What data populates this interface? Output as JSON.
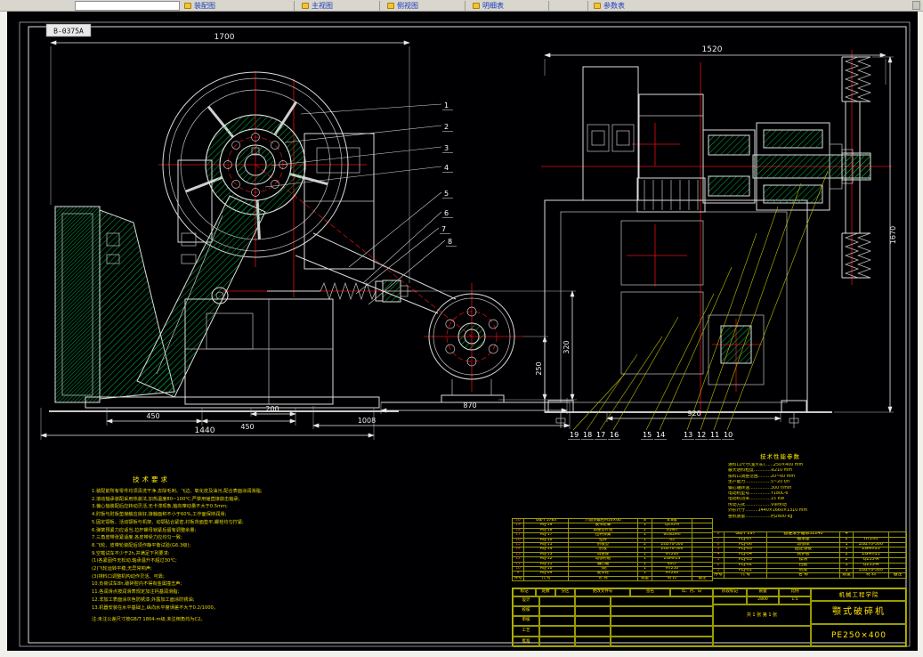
{
  "topbar": {
    "tabs": [
      {
        "label": "装配图"
      },
      {
        "label": "主视图"
      },
      {
        "label": "侧视图"
      },
      {
        "label": "明细表"
      },
      {
        "label": "参数表"
      }
    ]
  },
  "frame": {
    "doc_no": "B-0375A"
  },
  "dims": {
    "front": {
      "total_width": "1700",
      "left450": "450",
      "mid200": "200",
      "right450": "450",
      "base_width": "1440",
      "pulley_offset": "1008",
      "belt_center": "870",
      "h250": "250",
      "h320": "320"
    },
    "side": {
      "total_width": "1520",
      "total_height": "1670",
      "base_width": "920"
    }
  },
  "callouts": {
    "front": [
      "1",
      "2",
      "3",
      "4",
      "5",
      "6",
      "7",
      "8"
    ],
    "side": [
      "19",
      "18",
      "17",
      "16",
      "15",
      "14",
      "13",
      "12",
      "11",
      "10"
    ]
  },
  "tech_requirements": {
    "title": "技术要求",
    "lines": [
      "1.装配前所有零件均须清洗干净,去除毛刺、飞边、氧化皮及油污,配合表面涂润滑脂;",
      "2.滚动轴承装配采用热装法,加热温度80~100℃,严禁用锤直接敲击轴承;",
      "3.偏心轴装配后应转动灵活,无卡滞现象,轴向窜动量不大于0.5mm;",
      "4.肘板与肘板垫接触应良好,接触面积不小于60%,工作面保持润滑;",
      "5.固定颚板、活动颚板与机架、动颚贴合紧密,衬板背面垫平,螺栓均匀拧紧;",
      "6.弹簧预紧力应适当,拉杆螺母锁紧后留有调整余量;",
      "7.三角皮带张紧适度,各皮带受力应均匀一致;",
      "8.飞轮、皮带轮装配后须作静平衡试验(G6.3级);",
      "9.空载试车不少于2h,并满足下列要求:",
      "  (1)各紧固件无松动,轴承温升不超过30℃;",
      "  (2)飞轮运转平稳,无异常响声;",
      "  (3)排料口调整机构动作灵活、可靠;",
      "10.负荷试车8h,破碎腔内不得有金属撞击声;",
      "11.各润滑点按润滑表规定加注钙基润滑脂;",
      "12.非加工表面涂灰色防锈漆,外露加工面涂防锈油;",
      "13.机器安装在水平基础上,纵向水平度误差不大于0.2/1000。"
    ],
    "note": "注:未注公差尺寸按GB/T 1804-m级,未注倒角均为C2。"
  },
  "tech_params": {
    "title": "技术性能参数",
    "lines": [
      "进料口尺寸(宽×长)……250×400 mm",
      "最大进料粒度…………≤210 mm",
      "排料口调整范围………20~60 mm",
      "生产能力………………5~20 t/h",
      "偏心轴转速……………300 r/min",
      "电动机型号……………Y180L-6",
      "电动机功率……………15 kW",
      "传动方式………………V带传动",
      "外形尺寸………1440×1660×1310 mm",
      "整机质量………………约2800 kg"
    ]
  },
  "bom": {
    "columns": [
      "序号",
      "代  号",
      "名  称",
      "数量",
      "材  料",
      "备注"
    ],
    "left_rows": [
      [
        "20",
        "GB/T 5783",
        "六角头螺栓M16×60",
        "8",
        "8.8级",
        ""
      ],
      [
        "19",
        "PEJ-19",
        "皮带轮罩",
        "1",
        "Q235-A",
        ""
      ],
      [
        "18",
        "PEJ-18",
        "调整垫片组",
        "2",
        "65Mn",
        ""
      ],
      [
        "17",
        "PEJ-17",
        "拉杆弹簧",
        "1",
        "60Si2Mn",
        ""
      ],
      [
        "16",
        "PEJ-16",
        "拉杆",
        "1",
        "45",
        ""
      ],
      [
        "15",
        "PEJ-15",
        "肘板垫",
        "2",
        "ZG270-500",
        ""
      ],
      [
        "14",
        "PEJ-14",
        "肘板",
        "1",
        "ZG270-500",
        ""
      ],
      [
        "13",
        "PEJ-13",
        "调整座",
        "1",
        "HT200",
        ""
      ],
      [
        "12",
        "PEJ-12",
        "动颚衬板",
        "1",
        "ZGMn13",
        ""
      ],
      [
        "11",
        "PEJ-11",
        "偏心轴",
        "1",
        "40Cr",
        ""
      ],
      [
        "10",
        "PEJ-10",
        "飞轮",
        "1",
        "HT250",
        ""
      ],
      [
        "9",
        "PEJ-09",
        "皮带轮",
        "1",
        "HT200",
        ""
      ]
    ],
    "right_rows": [
      [
        "8",
        "GB/T 297",
        "圆锥滚子轴承32240",
        "4",
        "",
        ""
      ],
      [
        "7",
        "PEJ-07",
        "轴承座",
        "2",
        "HT200",
        ""
      ],
      [
        "6",
        "PEJ-06",
        "动颚体",
        "1",
        "ZG270-500",
        ""
      ],
      [
        "5",
        "PEJ-05",
        "固定颚板",
        "1",
        "ZGMn13",
        ""
      ],
      [
        "4",
        "PEJ-04",
        "侧护板",
        "2",
        "ZGMn13",
        ""
      ],
      [
        "3",
        "PEJ-03",
        "楔块",
        "2",
        "Q235-A",
        ""
      ],
      [
        "2",
        "PEJ-02",
        "挡板",
        "1",
        "Q235-A",
        ""
      ],
      [
        "1",
        "PEJ-01",
        "机架",
        "1",
        "ZG270-500",
        ""
      ]
    ]
  },
  "title_block": {
    "change_header": [
      "标记",
      "处数",
      "分区",
      "更改文件号",
      "签名",
      "年、月、日"
    ],
    "sign_rows": [
      "设计",
      "校核",
      "审核",
      "工艺",
      "批准"
    ],
    "stage_label": "阶段标记",
    "weight_label": "质量",
    "scale_label": "比例",
    "weight": "2800",
    "scale": "1:5",
    "sheet": "共 1 张  第 1 张",
    "unit": "机械工程学院",
    "product": "颚式破碎机",
    "drawing_no": "PE250×400"
  },
  "colors": {
    "paper": "#000000",
    "line": "#e8e8e8",
    "hatch": "#00b43c",
    "centerline": "#e01010",
    "annotation": "#ffee00",
    "link": "#1b3fbf"
  }
}
